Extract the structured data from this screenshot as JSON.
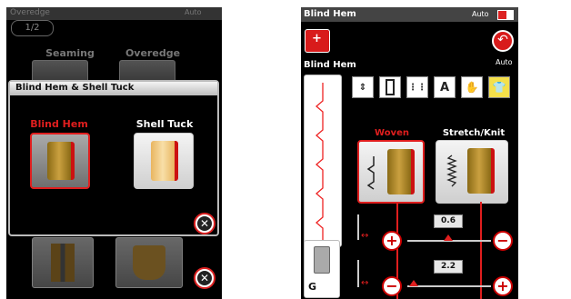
{
  "left": {
    "status": {
      "title": "Overedge",
      "right": "Auto"
    },
    "page_nav": "1/2",
    "categories": [
      "Seaming",
      "Overedge"
    ],
    "dialog": {
      "title": "Blind Hem & Shell Tuck",
      "options": [
        {
          "label": "Blind Hem",
          "selected": true
        },
        {
          "label": "Shell Tuck",
          "selected": false
        }
      ]
    },
    "close_glyph": "✕"
  },
  "right": {
    "status": {
      "title": "Blind Hem",
      "right": "Auto"
    },
    "stitch_name": "Blind Hem",
    "auto_label": "Auto",
    "toolbar": {
      "letter_a": "A"
    },
    "tabs": [
      {
        "label": "Woven",
        "active": true
      },
      {
        "label": "Stretch/Knit",
        "active": false
      }
    ],
    "width": {
      "value": "0.6"
    },
    "length": {
      "value": "2.2"
    },
    "foot": "G",
    "plus": "+",
    "minus": "−"
  },
  "colors": {
    "accent": "#e01e1e",
    "bg": "#000000"
  }
}
